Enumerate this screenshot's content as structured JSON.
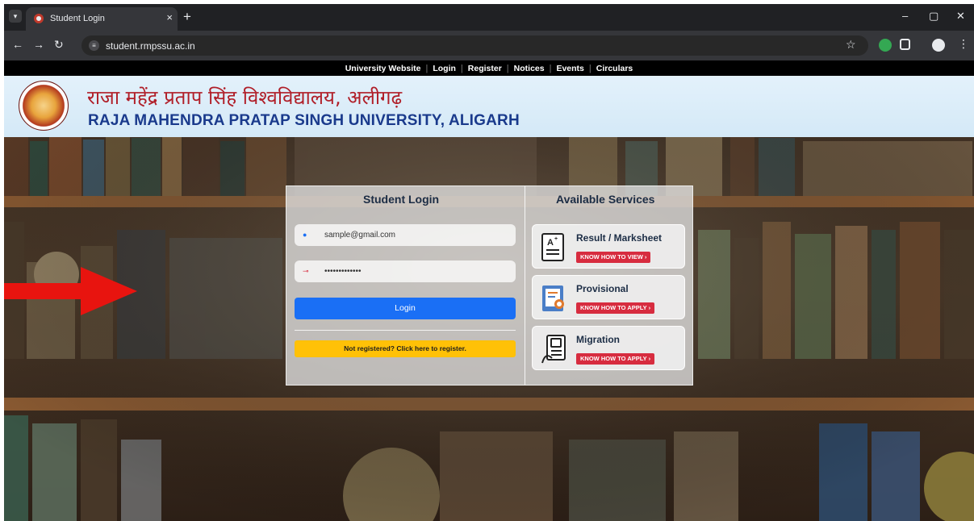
{
  "browser": {
    "tab_title": "Student Login",
    "tab_close": "×",
    "new_tab": "+",
    "url": "student.rmpssu.ac.in",
    "window_controls": [
      "–",
      "▢",
      "✕"
    ],
    "nav_icons": [
      "back-icon",
      "forward-icon",
      "reload-icon"
    ]
  },
  "topnav": {
    "links": [
      "University Website",
      "Login",
      "Register",
      "Notices",
      "Events",
      "Circulars"
    ]
  },
  "header": {
    "hindi_title": "राजा महेंद्र प्रताप सिंह विश्वविद्यालय, अलीगढ़",
    "english_title": "RAJA MAHENDRA PRATAP SINGH UNIVERSITY, ALIGARH"
  },
  "login": {
    "heading": "Student Login",
    "email_value": "sample@gmail.com",
    "password_value": "•••••••••••••",
    "login_label": "Login",
    "register_label": "Not registered? Click here to register."
  },
  "services": {
    "heading": "Available Services",
    "items": [
      {
        "title": "Result / Marksheet",
        "button": "KNOW HOW TO VIEW",
        "icon": "marksheet-icon"
      },
      {
        "title": "Provisional",
        "button": "KNOW HOW TO APPLY",
        "icon": "certificate-icon"
      },
      {
        "title": "Migration",
        "button": "KNOW HOW TO APPLY",
        "icon": "migration-icon"
      }
    ]
  },
  "colors": {
    "login_button": "#1a6ff5",
    "register_button": "#ffc107",
    "service_button": "#d72c3f",
    "hindi_title": "#b01e28",
    "english_title": "#1a3a8c",
    "arrow": "#e8140f"
  }
}
